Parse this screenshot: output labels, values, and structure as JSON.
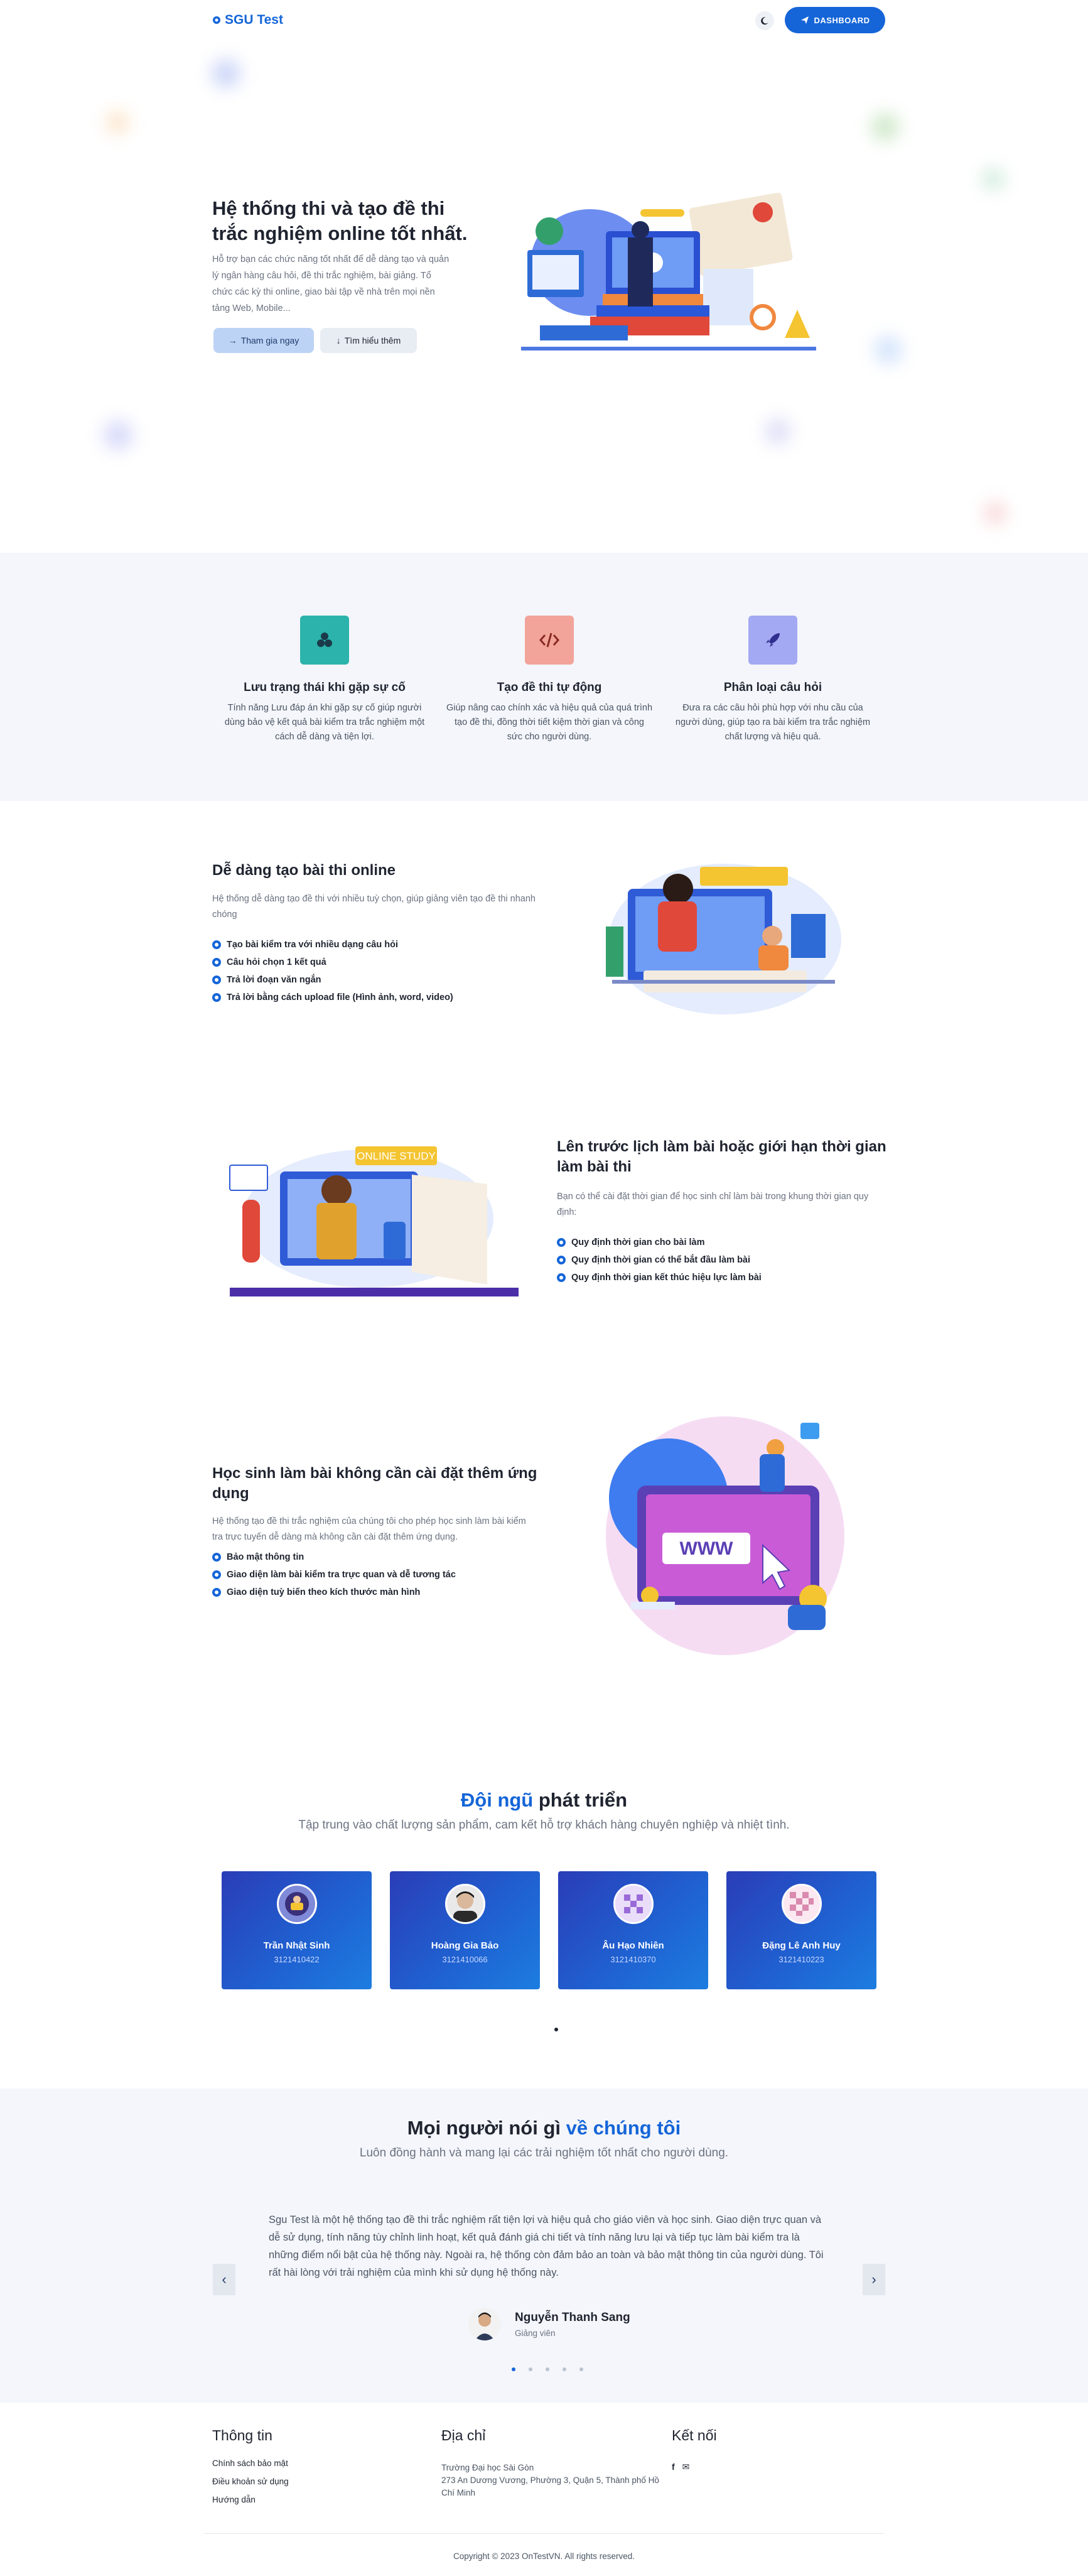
{
  "header": {
    "logo_text": "SGU Test",
    "dashboard_label": "DASHBOARD"
  },
  "hero": {
    "title": "Hệ thống thi và tạo đề thi trắc nghiệm online tốt nhất.",
    "description": "Hỗ trợ bạn các chức năng tốt nhất để dễ dàng tạo và quản lý ngân hàng câu hỏi, đề thi trắc nghiệm, bài giảng. Tổ chức các kỳ thi online, giao bài tập về nhà trên mọi nền tảng Web, Mobile...",
    "primary_button": "Tham gia ngay",
    "secondary_button": "Tìm hiểu thêm"
  },
  "features": [
    {
      "title": "Lưu trạng thái khi gặp sự cố",
      "desc": "Tính năng Lưu đáp án khi gặp sự cố giúp người dùng bảo vệ kết quả bài kiểm tra trắc nghiệm một cách dễ dàng và tiện lợi.",
      "icon": "cubes-icon",
      "color": "#2cb3ab"
    },
    {
      "title": "Tạo đề thi tự động",
      "desc": "Giúp nâng cao chính xác và hiệu quả của quá trình tạo đề thi, đồng thời tiết kiệm thời gian và công sức cho người dùng.",
      "icon": "code-icon",
      "color": "#ef8a7e"
    },
    {
      "title": "Phân loại câu hỏi",
      "desc": "Đưa ra các câu hỏi phù hợp với nhu cầu của người dùng, giúp tạo ra bài kiểm tra trắc nghiệm chất lượng và hiệu quả.",
      "icon": "rocket-icon",
      "color": "#8d93f0"
    }
  ],
  "section1": {
    "title": "Dễ dàng tạo bài thi online",
    "desc": "Hệ thống dễ dàng tạo đề thi với nhiều tuỳ chọn, giúp giảng viên tạo đề thi nhanh chóng",
    "bullets": [
      "Tạo bài kiểm tra với nhiều dạng câu hỏi",
      "Câu hỏi chọn 1 kết quả",
      "Trả lời đoạn văn ngắn",
      "Trả lời bằng cách upload file (Hình ảnh, word, video)"
    ]
  },
  "section2": {
    "title": "Lên trước lịch làm bài hoặc giới hạn thời gian làm bài thi",
    "desc": "Bạn có thể cài đặt thời gian để học sinh chỉ làm bài trong khung thời gian quy định:",
    "bullets": [
      "Quy định thời gian cho bài làm",
      "Quy định thời gian có thể bắt đầu làm bài",
      "Quy định thời gian kết thúc hiệu lực làm bài"
    ],
    "illustration_label": "ONLINE STUDY"
  },
  "section3": {
    "title": "Học sinh làm bài không cần cài đặt thêm ứng dụng",
    "desc": "Hệ thống tạo đề thi trắc nghiệm của chúng tôi cho phép học sinh làm bài kiểm tra trực tuyến dễ dàng mà không cần cài đặt thêm ứng dụng.",
    "bullets": [
      "Bảo mật thông tin",
      "Giao diện làm bài kiểm tra trực quan và dễ tương tác",
      "Giao diện tuỳ biến theo kích thước màn hình"
    ],
    "illustration_label": "WWW"
  },
  "team": {
    "title_highlight": "Đội ngũ",
    "title_rest": " phát triển",
    "subtitle": "Tập trung vào chất lượng sản phẩm, cam kết hỗ trợ khách hàng chuyên nghiệp và nhiệt tình.",
    "members": [
      {
        "name": "Trần Nhật Sinh",
        "id": "3121410422"
      },
      {
        "name": "Hoàng Gia Bảo",
        "id": "3121410066"
      },
      {
        "name": "Âu Hạo Nhiên",
        "id": "3121410370"
      },
      {
        "name": "Đặng Lê Anh Huy",
        "id": "3121410223"
      }
    ]
  },
  "testimonials": {
    "title_plain": "Mọi người nói gì ",
    "title_highlight": "về chúng tôi",
    "subtitle": "Luôn đồng hành và mang lại các trải nghiệm tốt nhất cho người dùng.",
    "quote": "Sgu Test là một hệ thống tạo đề thi trắc nghiệm rất tiện lợi và hiệu quả cho giáo viên và học sinh. Giao diện trực quan và dễ sử dụng, tính năng tùy chỉnh linh hoạt, kết quả đánh giá chi tiết và tính năng lưu lại và tiếp tục làm bài kiểm tra là những điểm nổi bật của hệ thống này. Ngoài ra, hệ thống còn đảm bảo an toàn và bảo mật thông tin của người dùng. Tôi rất hài lòng với trải nghiệm của mình khi sử dụng hệ thống này.",
    "author_name": "Nguyễn Thanh Sang",
    "author_role": "Giảng viên",
    "prev_arrow": "‹",
    "next_arrow": "›"
  },
  "footer": {
    "info_title": "Thông tin",
    "info_links": [
      "Chính sách bảo mật",
      "Điều khoản sử dụng",
      "Hướng dẫn"
    ],
    "address_title": "Địa chỉ",
    "address_line1": "Trường Đại học Sài Gòn",
    "address_line2": "273 An Dương Vương, Phường 3, Quận 5, Thành phố Hồ Chí Minh",
    "connect_title": "Kết nối",
    "facebook_glyph": "f",
    "messenger_glyph": "✉",
    "copyright": "Copyright © 2023 OnTestVN. All rights reserved."
  },
  "colors": {
    "brand": "#1565d8",
    "band": "#f4f6fb"
  }
}
